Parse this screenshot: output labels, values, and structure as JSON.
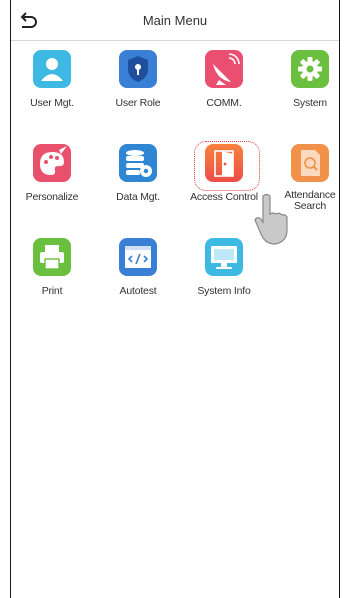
{
  "header": {
    "title": "Main Menu",
    "back_icon": "back-arrow-icon"
  },
  "menu": [
    {
      "label": "User Mgt.",
      "icon": "user-icon",
      "color": "#3db9e3"
    },
    {
      "label": "User Role",
      "icon": "shield-icon",
      "color": "#3a7fd6"
    },
    {
      "label": "COMM.",
      "icon": "satellite-dish-icon",
      "color": "#ea4f72"
    },
    {
      "label": "System",
      "icon": "gear-icon",
      "color": "#6bbf3e"
    },
    {
      "label": "Personalize",
      "icon": "palette-icon",
      "color": "#e8506c"
    },
    {
      "label": "Data Mgt.",
      "icon": "database-gear-icon",
      "color": "#2f86d2"
    },
    {
      "label": "Access Control",
      "icon": "door-icon",
      "color": "#f26b3a"
    },
    {
      "label": "Attendance\nSearch",
      "icon": "document-search-icon",
      "color": "#f2924a"
    },
    {
      "label": "Print",
      "icon": "printer-icon",
      "color": "#6bbf3e"
    },
    {
      "label": "Autotest",
      "icon": "code-window-icon",
      "color": "#3a7fd6"
    },
    {
      "label": "System Info",
      "icon": "monitor-icon",
      "color": "#3db9e3"
    }
  ],
  "selected_item": "Access Control"
}
